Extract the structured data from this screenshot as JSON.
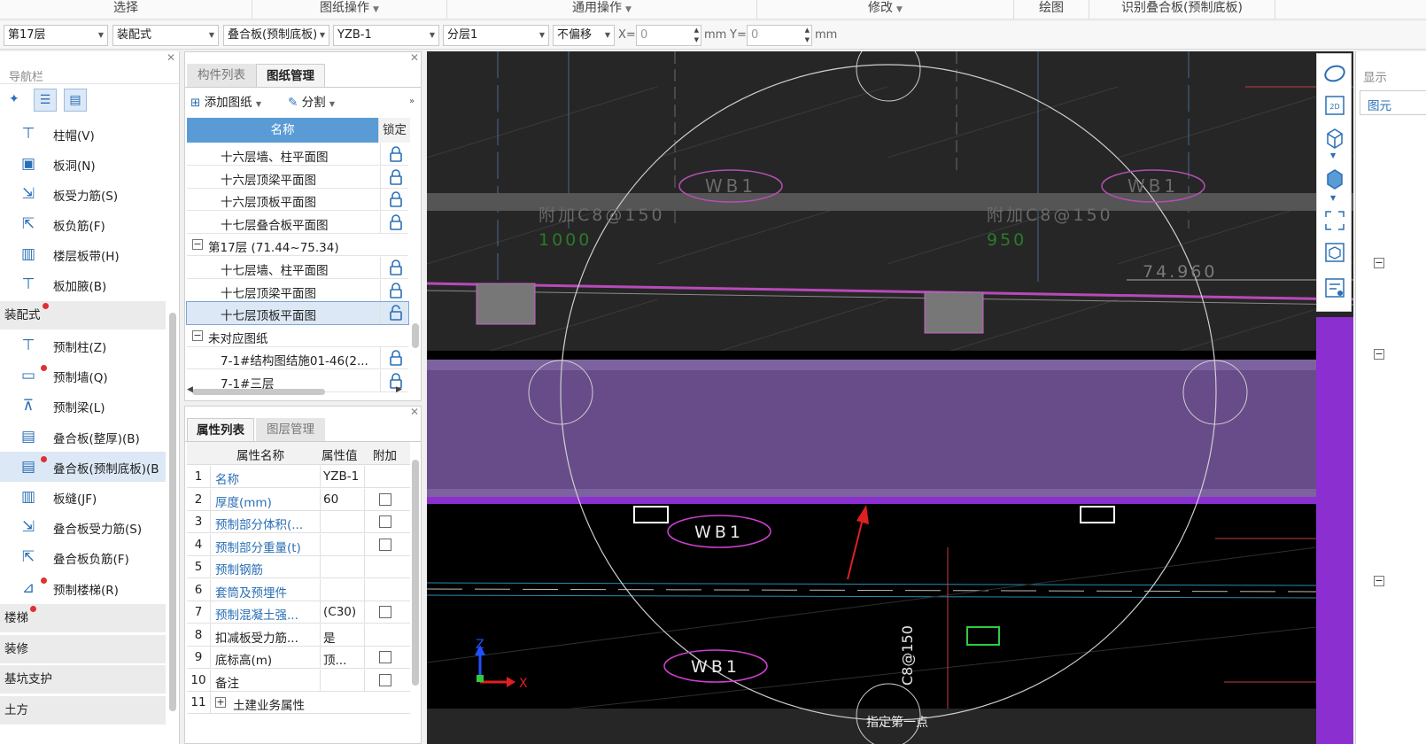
{
  "ribbon": {
    "groups": [
      {
        "label": "选择",
        "dropdown": false
      },
      {
        "label": "图纸操作",
        "dropdown": true
      },
      {
        "label": "通用操作",
        "dropdown": true
      },
      {
        "label": "修改",
        "dropdown": true
      },
      {
        "label": "绘图",
        "dropdown": false
      },
      {
        "label": "识别叠合板(预制底板)",
        "dropdown": false
      }
    ]
  },
  "toolbar": {
    "floor": "第17层",
    "category": "装配式",
    "component_type": "叠合板(预制底板)",
    "component_name": "YZB-1",
    "layer": "分层1",
    "offset": "不偏移",
    "x_label": "X=",
    "x_value": "0",
    "x_unit": "mm",
    "y_label": "Y=",
    "y_value": "0",
    "y_unit": "mm"
  },
  "nav": {
    "title": "导航栏",
    "items_top": [
      {
        "label": "柱帽(V)",
        "icon": "column-cap-icon"
      },
      {
        "label": "板洞(N)",
        "icon": "slab-hole-icon"
      },
      {
        "label": "板受力筋(S)",
        "icon": "slab-main-rebar-icon"
      },
      {
        "label": "板负筋(F)",
        "icon": "slab-negative-rebar-icon"
      },
      {
        "label": "楼层板带(H)",
        "icon": "floor-slab-strip-icon"
      },
      {
        "label": "板加腋(B)",
        "icon": "slab-haunch-icon"
      }
    ],
    "category_prefab": "装配式",
    "items_prefab": [
      {
        "label": "预制柱(Z)",
        "icon": "precast-column-icon",
        "dot": false
      },
      {
        "label": "预制墙(Q)",
        "icon": "precast-wall-icon",
        "dot": true
      },
      {
        "label": "预制梁(L)",
        "icon": "precast-beam-icon",
        "dot": false
      },
      {
        "label": "叠合板(整厚)(B)",
        "icon": "composite-slab-full-icon",
        "dot": false
      },
      {
        "label": "叠合板(预制底板)(B",
        "icon": "composite-slab-precast-icon",
        "dot": true,
        "selected": true
      },
      {
        "label": "板缝(JF)",
        "icon": "slab-joint-icon",
        "dot": false
      },
      {
        "label": "叠合板受力筋(S)",
        "icon": "composite-slab-rebar-icon",
        "dot": false
      },
      {
        "label": "叠合板负筋(F)",
        "icon": "composite-slab-negative-rebar-icon",
        "dot": false
      },
      {
        "label": "预制楼梯(R)",
        "icon": "precast-stair-icon",
        "dot": true
      }
    ],
    "categories_bottom": [
      {
        "label": "楼梯",
        "dot": true
      },
      {
        "label": "装修",
        "dot": false
      },
      {
        "label": "基坑支护",
        "dot": false
      },
      {
        "label": "土方",
        "dot": false
      }
    ]
  },
  "drawing_panel": {
    "tabs": [
      "构件列表",
      "图纸管理"
    ],
    "active_tab": "图纸管理",
    "add_drawing": "添加图纸",
    "split": "分割",
    "col_name": "名称",
    "col_lock": "锁定",
    "rows": [
      {
        "label": "十六层墙、柱平面图",
        "type": "item"
      },
      {
        "label": "十六层顶梁平面图",
        "type": "item"
      },
      {
        "label": "十六层顶板平面图",
        "type": "item"
      },
      {
        "label": "十七层叠合板平面图",
        "type": "item"
      },
      {
        "label": "第17层 (71.44~75.34)",
        "type": "group"
      },
      {
        "label": "十七层墙、柱平面图",
        "type": "item"
      },
      {
        "label": "十七层顶梁平面图",
        "type": "item"
      },
      {
        "label": "十七层顶板平面图",
        "type": "item",
        "selected": true
      },
      {
        "label": "未对应图纸",
        "type": "group"
      },
      {
        "label": "7-1#结构图结施01-46(2...",
        "type": "item"
      },
      {
        "label": "7-1#三层",
        "type": "item"
      }
    ]
  },
  "property_panel": {
    "tabs": [
      "属性列表",
      "图层管理"
    ],
    "active_tab": "属性列表",
    "col_name": "属性名称",
    "col_value": "属性值",
    "col_extra": "附加",
    "rows": [
      {
        "no": "1",
        "name": "名称",
        "value": "YZB-1",
        "blue": true,
        "check": false
      },
      {
        "no": "2",
        "name": "厚度(mm)",
        "value": "60",
        "blue": true,
        "check": true
      },
      {
        "no": "3",
        "name": "预制部分体积(...",
        "value": "",
        "blue": true,
        "check": true
      },
      {
        "no": "4",
        "name": "预制部分重量(t)",
        "value": "",
        "blue": true,
        "check": true
      },
      {
        "no": "5",
        "name": "预制钢筋",
        "value": "",
        "blue": true,
        "check": false
      },
      {
        "no": "6",
        "name": "套筒及预埋件",
        "value": "",
        "blue": true,
        "check": false
      },
      {
        "no": "7",
        "name": "预制混凝土强...",
        "value": "(C30)",
        "blue": true,
        "check": true
      },
      {
        "no": "8",
        "name": "扣减板受力筋...",
        "value": "是",
        "blue": false,
        "check": false
      },
      {
        "no": "9",
        "name": "底标高(m)",
        "value": "顶...",
        "blue": false,
        "check": true
      },
      {
        "no": "10",
        "name": "备注",
        "value": "",
        "blue": false,
        "check": true
      },
      {
        "no": "11",
        "name": "土建业务属性",
        "value": "",
        "blue": false,
        "check": false,
        "expand": true
      }
    ]
  },
  "canvas": {
    "labels": {
      "wb1": "WB1",
      "rebar_a": "附加C8@150",
      "rebar_a_len": "1000",
      "rebar_b": "附加C8@150",
      "rebar_b_len": "950",
      "elevation": "74.960",
      "vertical_rebar": "C8@150",
      "prompt": "指定第一点",
      "axis_x": "X",
      "axis_y": "Z"
    }
  },
  "right_panel": {
    "title": "显示",
    "tab": "图元"
  },
  "colors": {
    "accent_blue": "#2a6fb5",
    "selection": "#dce8f6",
    "slab_purple": "#6b4e8c",
    "magenta": "#c83cc8",
    "red_dot": "#e03030"
  }
}
